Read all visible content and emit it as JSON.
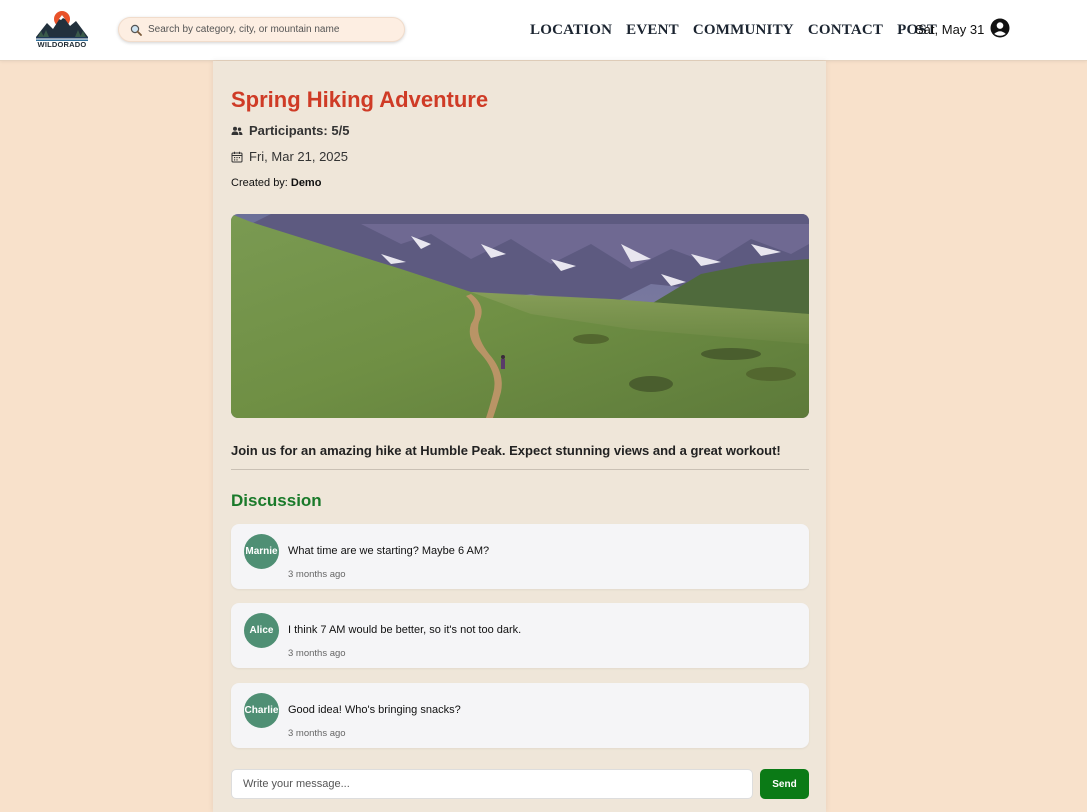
{
  "header": {
    "logo_text": "WILDORADO",
    "search": {
      "placeholder": "Search by category, city, or mountain name",
      "value": ""
    },
    "nav": [
      "LOCATION",
      "EVENT",
      "COMMUNITY",
      "CONTACT",
      "POST"
    ],
    "date": "Sat, May 31"
  },
  "event": {
    "title": "Spring Hiking Adventure",
    "participants": "Participants: 5/5",
    "date": "Fri, Mar 21, 2025",
    "created_by_label": "Created by:",
    "created_by": "Demo",
    "description": "Join us for an amazing hike at Humble Peak. Expect stunning views and a great workout!"
  },
  "discussion": {
    "title": "Discussion",
    "comments": [
      {
        "author": "Marnie",
        "text": "What time are we starting? Maybe 6 AM?",
        "time": "3 months ago"
      },
      {
        "author": "Alice",
        "text": "I think 7 AM would be better, so it's not too dark.",
        "time": "3 months ago"
      },
      {
        "author": "Charlie",
        "text": "Good idea! Who's bringing snacks?",
        "time": "3 months ago"
      }
    ],
    "input_placeholder": "Write your message...",
    "send_label": "Send"
  },
  "colors": {
    "page_bg": "#f8e1cb",
    "panel_bg": "#efe6d9",
    "title_red": "#cf3b26",
    "discussion_green": "#1a7a2a",
    "avatar_green": "#4f8f74",
    "send_green": "#0b7a16"
  },
  "icons": [
    "search-icon",
    "user-account-icon",
    "participants-icon",
    "calendar-icon"
  ]
}
